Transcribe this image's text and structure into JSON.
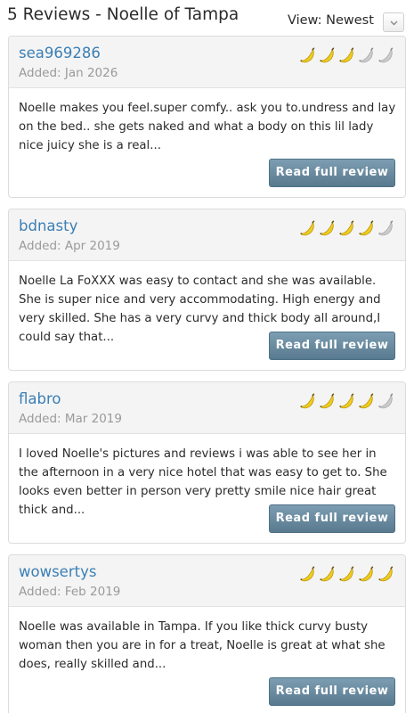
{
  "header": {
    "title": "5 Reviews - Noelle of Tampa",
    "view_label": "View: Newest"
  },
  "colors": {
    "reviewer_link": "#3b7fb5",
    "banana_filled": "#f0cd1e",
    "banana_empty": "#cccccc",
    "button": "#6a8ca1"
  },
  "reviews": [
    {
      "reviewer": "sea969286",
      "date": "Added: Jan 2026",
      "rating": 3,
      "rating_max": 5,
      "text": "Noelle makes you feel.super comfy.. ask you to.undress and lay on the bed.. she gets naked and what a body on this lil lady nice juicy she is a real...",
      "button_label": "Read full review"
    },
    {
      "reviewer": "bdnasty",
      "date": "Added: Apr 2019",
      "rating": 4,
      "rating_max": 5,
      "text": "Noelle La FoXXX was easy to contact and she was available. She is super nice and very accommodating. High energy and very skilled. She has a very curvy and thick body all around,I could say that...",
      "button_label": "Read full review"
    },
    {
      "reviewer": "flabro",
      "date": "Added: Mar 2019",
      "rating": 4,
      "rating_max": 5,
      "text": "I loved Noelle's pictures and reviews i was able to see her in the afternoon in a very nice hotel that was easy to get to. She looks even better in person very pretty smile nice hair great thick and...",
      "button_label": "Read full review"
    },
    {
      "reviewer": "wowsertys",
      "date": "Added: Feb 2019",
      "rating": 5,
      "rating_max": 5,
      "text": "Noelle was available in Tampa. If you like thick curvy busty woman then you are in for a treat, Noelle is great at what she does, really skilled and...",
      "button_label": "Read full review"
    }
  ],
  "icons": {
    "rating": "banana-icon",
    "select": "chevron-down-icon"
  }
}
